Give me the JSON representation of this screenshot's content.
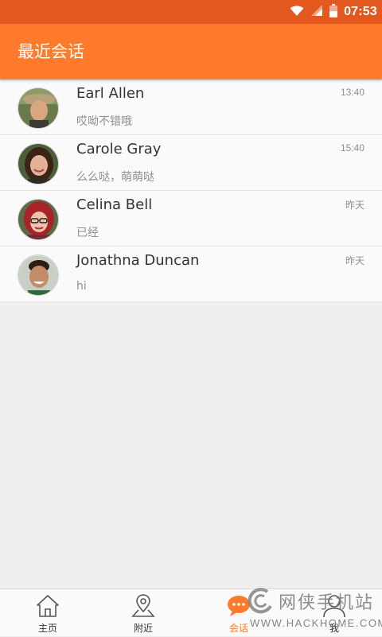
{
  "status_bar": {
    "time": "07:53",
    "icons": [
      "wifi-icon",
      "signal-icon",
      "battery-icon"
    ],
    "background": "#e2581f"
  },
  "app_bar": {
    "title": "最近会话",
    "background": "#ff7a2b"
  },
  "conversations": [
    {
      "name": "Earl Allen",
      "message": "哎呦不错哦",
      "time": "13:40",
      "avatar": "avatar-earl-allen"
    },
    {
      "name": "Carole Gray",
      "message": "么么哒，萌萌哒",
      "time": "15:40",
      "avatar": "avatar-carole-gray"
    },
    {
      "name": "Celina Bell",
      "message": "已经",
      "time": "昨天",
      "avatar": "avatar-celina-bell"
    },
    {
      "name": "Jonathna Duncan",
      "message": "hi",
      "time": "昨天",
      "avatar": "avatar-jonathna-duncan"
    }
  ],
  "bottom_nav": {
    "items": [
      {
        "label": "主页",
        "icon": "home-icon"
      },
      {
        "label": "附近",
        "icon": "location-pin-icon"
      },
      {
        "label": "会话",
        "icon": "chat-bubble-icon",
        "active": true
      },
      {
        "label": "我",
        "icon": "person-icon"
      }
    ],
    "active_color": "#ff7a2b"
  },
  "watermark": {
    "brand": "网侠手机站",
    "url": "WWW.HACKHOME.COM"
  }
}
